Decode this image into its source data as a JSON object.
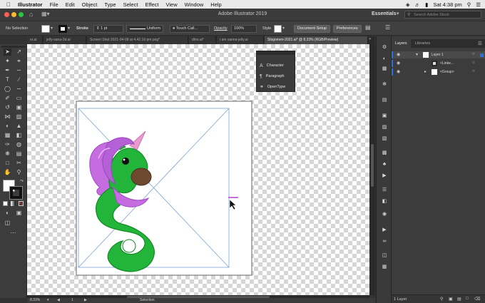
{
  "menubar": {
    "app_name": "Illustrator",
    "items": [
      "File",
      "Edit",
      "Object",
      "Type",
      "Select",
      "Effect",
      "View",
      "Window",
      "Help"
    ],
    "clock": "Sat 4:38 pm"
  },
  "appbar": {
    "title": "Adobe Illustrator 2019",
    "workspace": "Essentials",
    "search_placeholder": "Search Adobe Stock"
  },
  "controlbar": {
    "selection": "No Selection",
    "stroke_label": "Stroke",
    "stroke_value": "1 pt",
    "stroke_style": "Uniform",
    "brush": "Touch Call...",
    "opacity_label": "Opacity",
    "opacity_value": "100%",
    "style_label": "Style",
    "document_setup": "Document Setup",
    "preferences": "Preferences"
  },
  "tabs": [
    {
      "label": "er.ai"
    },
    {
      "label": "jelly-sana-3d.ai"
    },
    {
      "label": "Screen Shot 2021-04-08 at 4.42.16 pm.png*"
    },
    {
      "label": "dino.ai*"
    },
    {
      "label": "i am sanna-jelly.ai"
    },
    {
      "label": "Slogomen-2021.ai* @ 8.33% (RGB/Preview)"
    }
  ],
  "character_panel": {
    "items": [
      "Character",
      "Paragraph",
      "OpenType"
    ]
  },
  "layers_panel": {
    "tabs": [
      "Layers",
      "Libraries"
    ],
    "rows": [
      {
        "name": "Layer 1"
      },
      {
        "name": "<Linke..."
      },
      {
        "name": "<Group>"
      }
    ],
    "count": "1 Layer"
  },
  "statusbar": {
    "zoom": "8.33%",
    "page": "1",
    "tool": "Selection"
  },
  "colors": {
    "accent": "#2d6fde",
    "unicorn_green": "#22b53a",
    "mane_purple": "#c56de0",
    "horn_pink": "#e89ad0"
  }
}
